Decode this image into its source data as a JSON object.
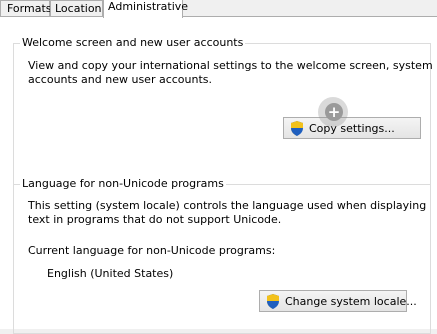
{
  "tabs": [
    {
      "label": "Formats"
    },
    {
      "label": "Location"
    },
    {
      "label": "Administrative"
    }
  ],
  "welcome": {
    "title": "Welcome screen and new user accounts",
    "description_line1": "View and copy your international settings to the welcome screen, system",
    "description_line2": "accounts and new user accounts.",
    "copy_button": "Copy settings..."
  },
  "nonunicode": {
    "title": "Language for non-Unicode programs",
    "description_line1": "This setting (system locale) controls the language used when displaying",
    "description_line2": "text in programs that do not support Unicode.",
    "current_label": "Current language for non-Unicode programs:",
    "current_value": "English (United States)",
    "change_button": "Change system locale..."
  },
  "icons": {
    "button_icon": "uac-shield-icon",
    "cursor": "plus-cursor-icon"
  }
}
